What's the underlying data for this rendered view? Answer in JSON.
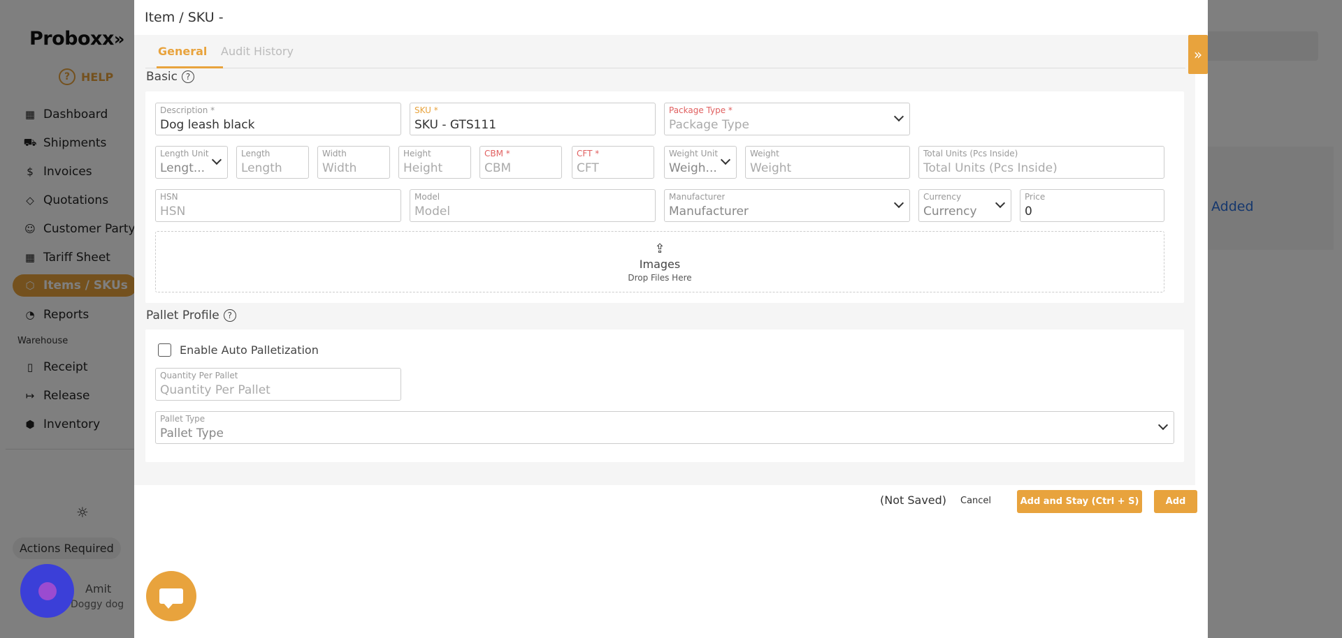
{
  "sidebar": {
    "logo": "Proboxx",
    "help_label": "HELP",
    "items": [
      {
        "label": "Dashboard",
        "icon": "grid-icon"
      },
      {
        "label": "Shipments",
        "icon": "truck-icon"
      },
      {
        "label": "Invoices",
        "icon": "dollar-icon"
      },
      {
        "label": "Quotations",
        "icon": "tag-icon"
      },
      {
        "label": "Customer Party",
        "icon": "users-icon"
      },
      {
        "label": "Tariff Sheet",
        "icon": "table-icon"
      },
      {
        "label": "Items / SKUs",
        "icon": "box-icon"
      },
      {
        "label": "Reports",
        "icon": "pie-chart-icon"
      }
    ],
    "section_warehouse": "Warehouse",
    "warehouse_items": [
      {
        "label": "Receipt",
        "icon": "file-icon"
      },
      {
        "label": "Release",
        "icon": "logout-icon"
      },
      {
        "label": "Inventory",
        "icon": "cube-icon"
      }
    ],
    "actions_required": "Actions Required",
    "user_name": "Amit",
    "user_sub": "Doggy dog"
  },
  "background": {
    "added_text": "Added"
  },
  "modal": {
    "title": "Item / SKU -",
    "tabs": {
      "general": "General",
      "audit": "Audit History"
    },
    "expand_icon": "»",
    "basic": {
      "title": "Basic",
      "description": {
        "label": "Description *",
        "value": "Dog leash black"
      },
      "sku": {
        "label": "SKU *",
        "value": "SKU - GTS111"
      },
      "package_type": {
        "label": "Package Type *",
        "placeholder": "Package Type"
      },
      "length_unit": {
        "label": "Length Unit",
        "placeholder": "Lengt..."
      },
      "length": {
        "label": "Length",
        "placeholder": "Length"
      },
      "width": {
        "label": "Width",
        "placeholder": "Width"
      },
      "height": {
        "label": "Height",
        "placeholder": "Height"
      },
      "cbm": {
        "label": "CBM *",
        "placeholder": "CBM"
      },
      "cft": {
        "label": "CFT *",
        "placeholder": "CFT"
      },
      "weight_unit": {
        "label": "Weight Unit",
        "placeholder": "Weigh..."
      },
      "weight": {
        "label": "Weight",
        "placeholder": "Weight"
      },
      "total_units": {
        "label": "Total Units (Pcs Inside)",
        "placeholder": "Total Units (Pcs Inside)"
      },
      "hsn": {
        "label": "HSN",
        "placeholder": "HSN"
      },
      "model": {
        "label": "Model",
        "placeholder": "Model"
      },
      "manufacturer": {
        "label": "Manufacturer",
        "placeholder": "Manufacturer"
      },
      "currency": {
        "label": "Currency",
        "placeholder": "Currency"
      },
      "price": {
        "label": "Price",
        "value": "0"
      },
      "images": {
        "title": "Images",
        "sub": "Drop Files Here"
      }
    },
    "pallet": {
      "title": "Pallet Profile",
      "auto_palletization": "Enable Auto Palletization",
      "qty_per_pallet": {
        "label": "Quantity Per Pallet",
        "placeholder": "Quantity Per Pallet"
      },
      "pallet_type": {
        "label": "Pallet Type",
        "placeholder": "Pallet Type"
      }
    },
    "footer": {
      "status": "(Not Saved)",
      "cancel": "Cancel",
      "add_and_stay": "Add and Stay (Ctrl + S)",
      "add": "Add"
    }
  },
  "colors": {
    "accent": "#e8a33d",
    "required_red": "#e06060"
  }
}
